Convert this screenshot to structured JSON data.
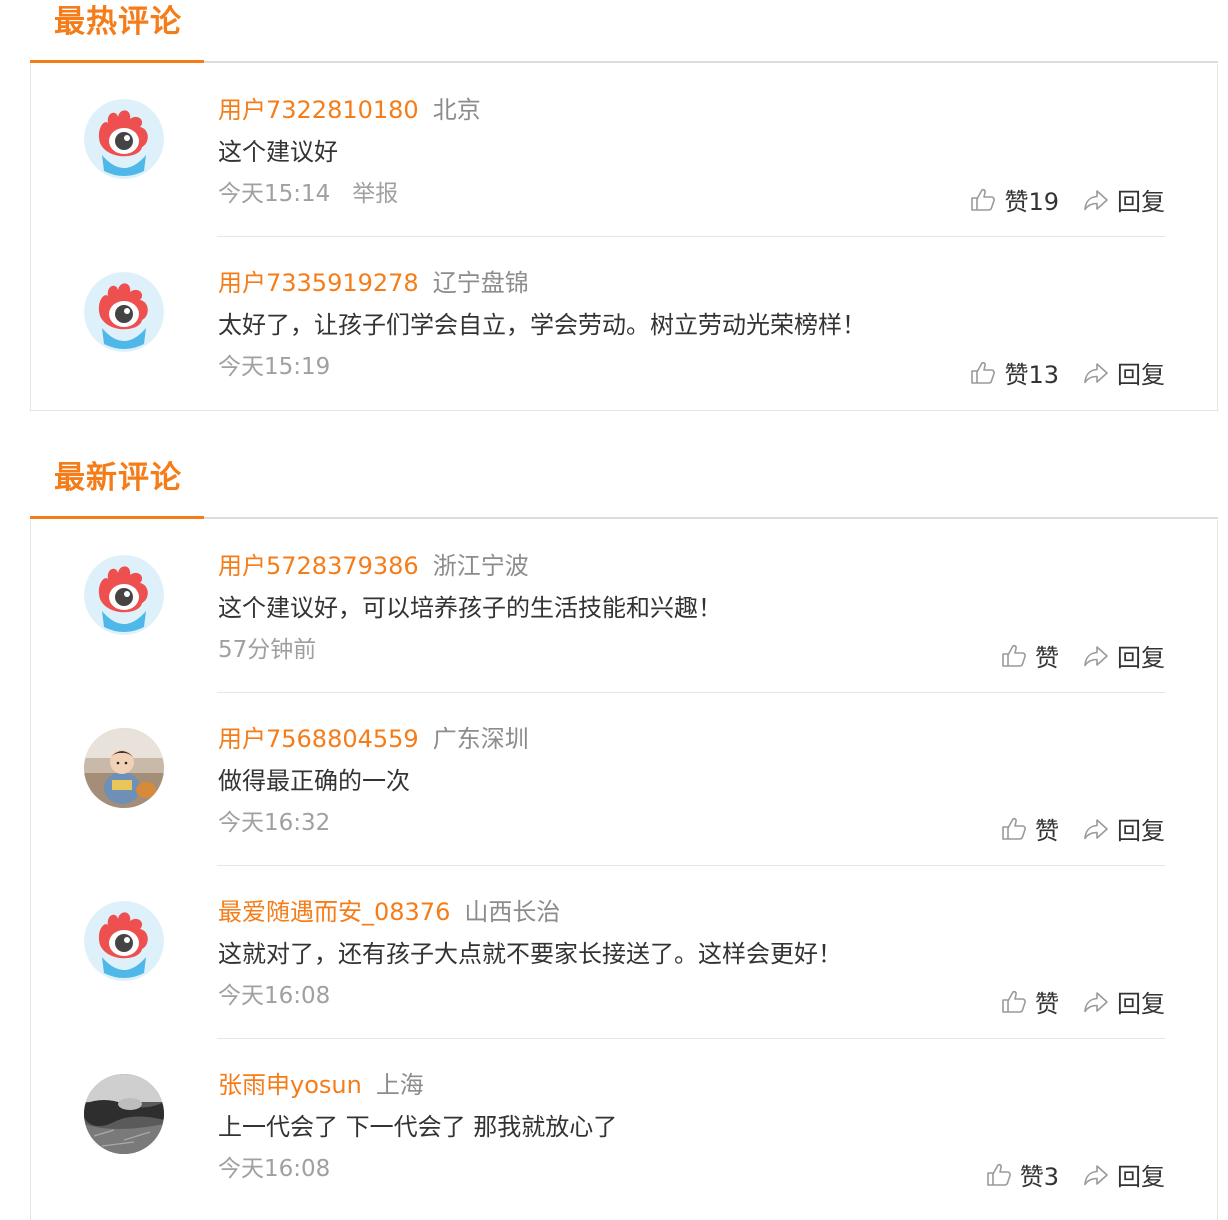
{
  "hot": {
    "title": "最热评论",
    "comments": [
      {
        "user": "用户7322810180",
        "location": "北京",
        "text": "这个建议好",
        "time": "今天15:14",
        "report": "举报",
        "like": "赞19",
        "reply": "回复",
        "avatar": "logo"
      },
      {
        "user": "用户7335919278",
        "location": "辽宁盘锦",
        "text": "太好了，让孩子们学会自立，学会劳动。树立劳动光荣榜样！",
        "time": "今天15:19",
        "like": "赞13",
        "reply": "回复",
        "avatar": "logo"
      }
    ]
  },
  "latest": {
    "title": "最新评论",
    "comments": [
      {
        "user": "用户5728379386",
        "location": "浙江宁波",
        "text": "这个建议好，可以培养孩子的生活技能和兴趣！",
        "time": "57分钟前",
        "like": "赞",
        "reply": "回复",
        "avatar": "logo"
      },
      {
        "user": "用户7568804559",
        "location": "广东深圳",
        "text": "做得最正确的一次",
        "time": "今天16:32",
        "like": "赞",
        "reply": "回复",
        "avatar": "child-photo"
      },
      {
        "user": "最爱随遇而安_08376",
        "location": "山西长治",
        "text": "这就对了，还有孩子大点就不要家长接送了。这样会更好！",
        "time": "今天16:08",
        "like": "赞",
        "reply": "回复",
        "avatar": "logo"
      },
      {
        "user": "张雨申yosun",
        "location": "上海",
        "text": "上一代会了 下一代会了 那我就放心了",
        "time": "今天16:08",
        "like": "赞3",
        "reply": "回复",
        "avatar": "bw-photo"
      }
    ]
  },
  "colors": {
    "accent": "#f57d19",
    "muted": "#a0a0a0",
    "location": "#8c8c8c"
  },
  "icons": {
    "like": "thumbs-up-icon",
    "reply": "share-arrow-icon"
  }
}
